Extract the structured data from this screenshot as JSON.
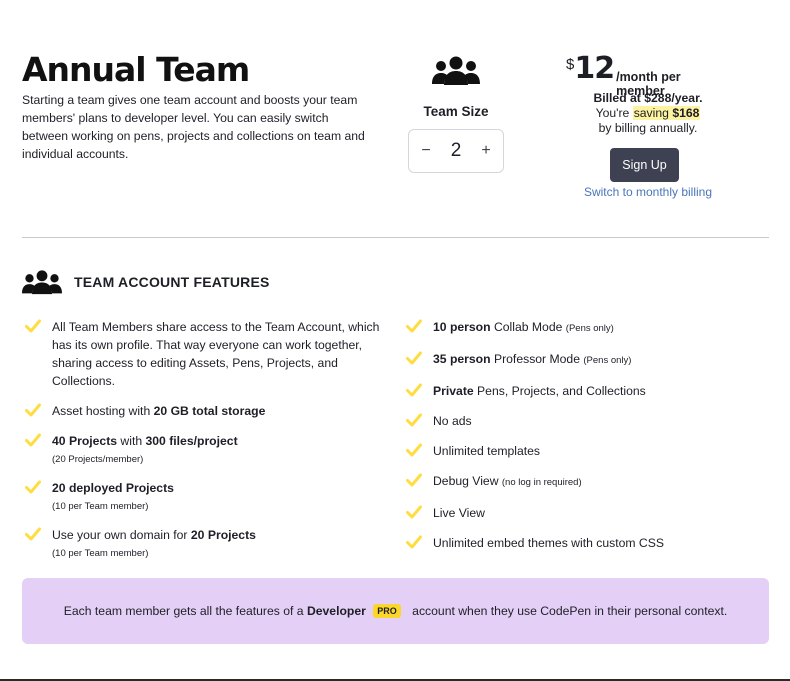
{
  "plan": {
    "title": "Annual Team",
    "description": "Starting a team gives one team account and boosts your team members' plans to developer level. You can easily switch between working on pens, projects and collections on team and individual accounts."
  },
  "team_size": {
    "label": "Team Size",
    "minus": "−",
    "value": "2",
    "plus": "+"
  },
  "pricing": {
    "currency": "$",
    "amount": "12",
    "period": "/month per member",
    "billed": "Billed at $288/year.",
    "saving_prefix": "You're",
    "saving_word": "saving",
    "saving_amount": "$168",
    "by_billing": "by billing annually.",
    "signup_label": "Sign Up",
    "switch_label": "Switch to monthly billing"
  },
  "features": {
    "heading": "TEAM ACCOUNT FEATURES",
    "left": [
      {
        "text": "All Team Members share access to the Team Account, which has its own profile. That way everyone can work together, sharing access to editing Assets, Pens, Projects, and Collections."
      },
      {
        "pre": "Asset hosting with ",
        "bold": "20 GB total storage"
      },
      {
        "bold": "40 Projects",
        "post": " with ",
        "bold2": "300 files/project",
        "sub": "(20 Projects/member)"
      },
      {
        "bold": "20 deployed Projects",
        "sub": "(10 per Team member)"
      },
      {
        "pre": "Use your own domain for ",
        "bold": "20 Projects",
        "sub": "(10 per Team member)"
      }
    ],
    "right": [
      {
        "bold": "10 person",
        "post": " Collab Mode ",
        "small": "(Pens only)"
      },
      {
        "bold": "35 person",
        "post": " Professor Mode ",
        "small": "(Pens only)"
      },
      {
        "bold": "Private",
        "post": " Pens, Projects, and Collections"
      },
      {
        "text": "No ads"
      },
      {
        "text": "Unlimited templates"
      },
      {
        "post": "Debug View ",
        "small": "(no log in required)"
      },
      {
        "text": "Live View"
      },
      {
        "text": "Unlimited embed themes with custom CSS"
      }
    ]
  },
  "banner": {
    "pre": "Each team member gets all the features of a ",
    "bold": "Developer",
    "badge": "PRO",
    "post": " account when they use CodePen in their personal context."
  },
  "colors": {
    "check": "#ffdd40",
    "banner_bg": "#e4d0f6",
    "button_bg": "#3e4152",
    "link": "#4a76b8",
    "badge": "#fbd72b"
  }
}
